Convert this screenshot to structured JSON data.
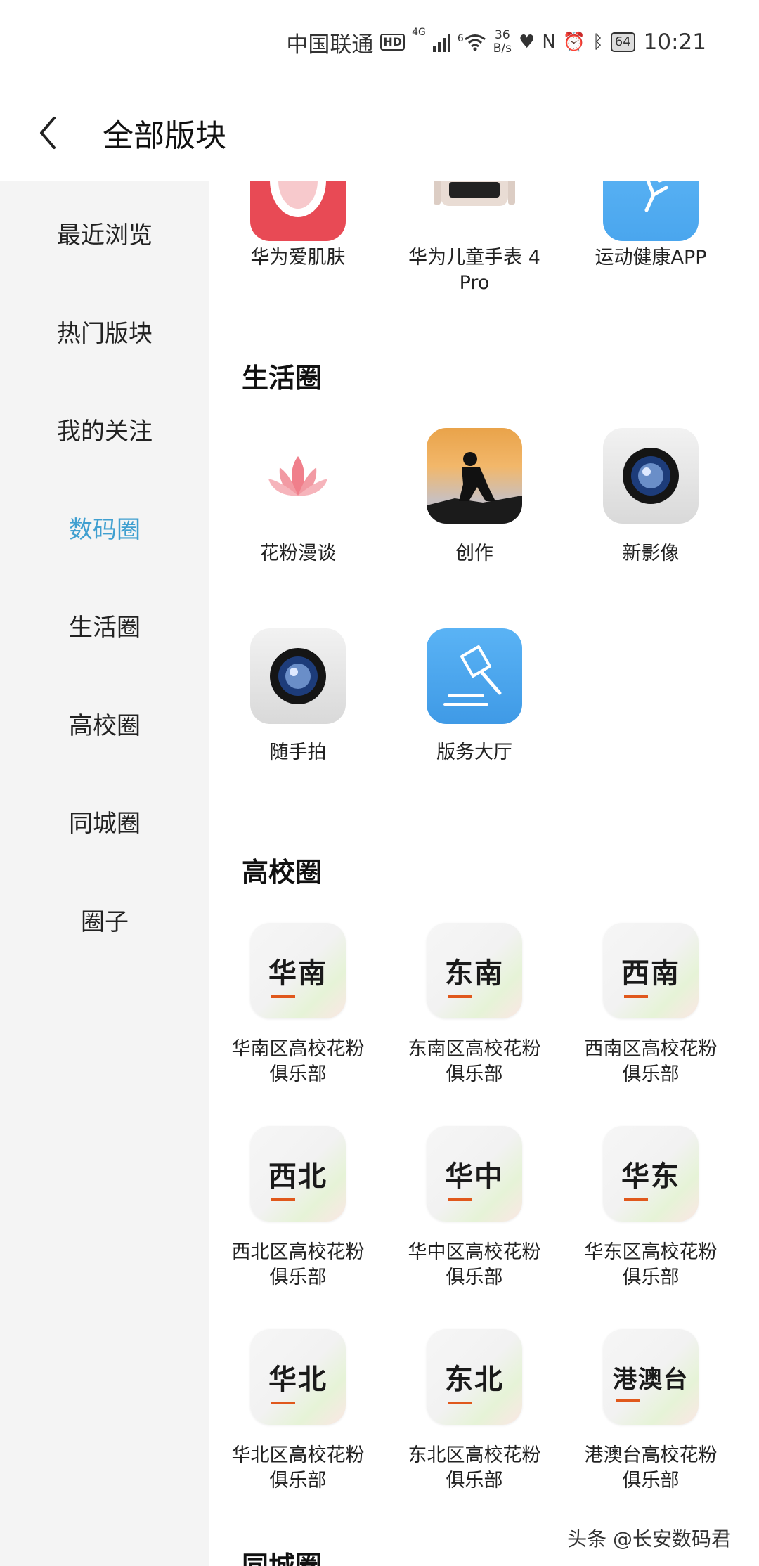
{
  "status_bar": {
    "carrier": "中国联通",
    "hd": "HD",
    "network": "4G",
    "wifi_badge": "6",
    "speed_value": "36",
    "speed_unit": "B/s",
    "battery": "64",
    "time": "10:21"
  },
  "header": {
    "title": "全部版块"
  },
  "sidebar": {
    "items": [
      {
        "label": "最近浏览"
      },
      {
        "label": "热门版块"
      },
      {
        "label": "我的关注"
      },
      {
        "label": "数码圈"
      },
      {
        "label": "生活圈"
      },
      {
        "label": "高校圈"
      },
      {
        "label": "同城圈"
      },
      {
        "label": "圈子"
      }
    ],
    "active_index": 3,
    "active_color": "#3f9fd0"
  },
  "digital_partial": {
    "tiles": [
      {
        "label": "华为爱肌肤",
        "icon": "skin-app-icon"
      },
      {
        "label": "华为儿童手表 4 Pro",
        "icon": "kids-watch-icon"
      },
      {
        "label": "运动健康APP",
        "icon": "health-app-icon"
      }
    ]
  },
  "life_circle": {
    "title": "生活圈",
    "tiles": [
      {
        "label": "花粉漫谈",
        "icon": "lotus-icon"
      },
      {
        "label": "创作",
        "icon": "sunset-photo-icon"
      },
      {
        "label": "新影像",
        "icon": "camera-lens-icon"
      },
      {
        "label": "随手拍",
        "icon": "camera-lens-icon"
      },
      {
        "label": "版务大厅",
        "icon": "gavel-icon"
      }
    ]
  },
  "campus_circle": {
    "title": "高校圈",
    "tiles": [
      {
        "icon_text": "华南",
        "label_1": "华南区高校花粉",
        "label_2": "俱乐部"
      },
      {
        "icon_text": "东南",
        "label_1": "东南区高校花粉",
        "label_2": "俱乐部"
      },
      {
        "icon_text": "西南",
        "label_1": "西南区高校花粉",
        "label_2": "俱乐部"
      },
      {
        "icon_text": "西北",
        "label_1": "西北区高校花粉",
        "label_2": "俱乐部"
      },
      {
        "icon_text": "华中",
        "label_1": "华中区高校花粉",
        "label_2": "俱乐部"
      },
      {
        "icon_text": "华东",
        "label_1": "华东区高校花粉",
        "label_2": "俱乐部"
      },
      {
        "icon_text": "华北",
        "label_1": "华北区高校花粉",
        "label_2": "俱乐部"
      },
      {
        "icon_text": "东北",
        "label_1": "东北区高校花粉",
        "label_2": "俱乐部"
      },
      {
        "icon_text": "港澳台",
        "label_1": "港澳台高校花粉",
        "label_2": "俱乐部"
      }
    ]
  },
  "city_circle": {
    "title": "同城圈"
  },
  "watermark": "头条 @长安数码君"
}
